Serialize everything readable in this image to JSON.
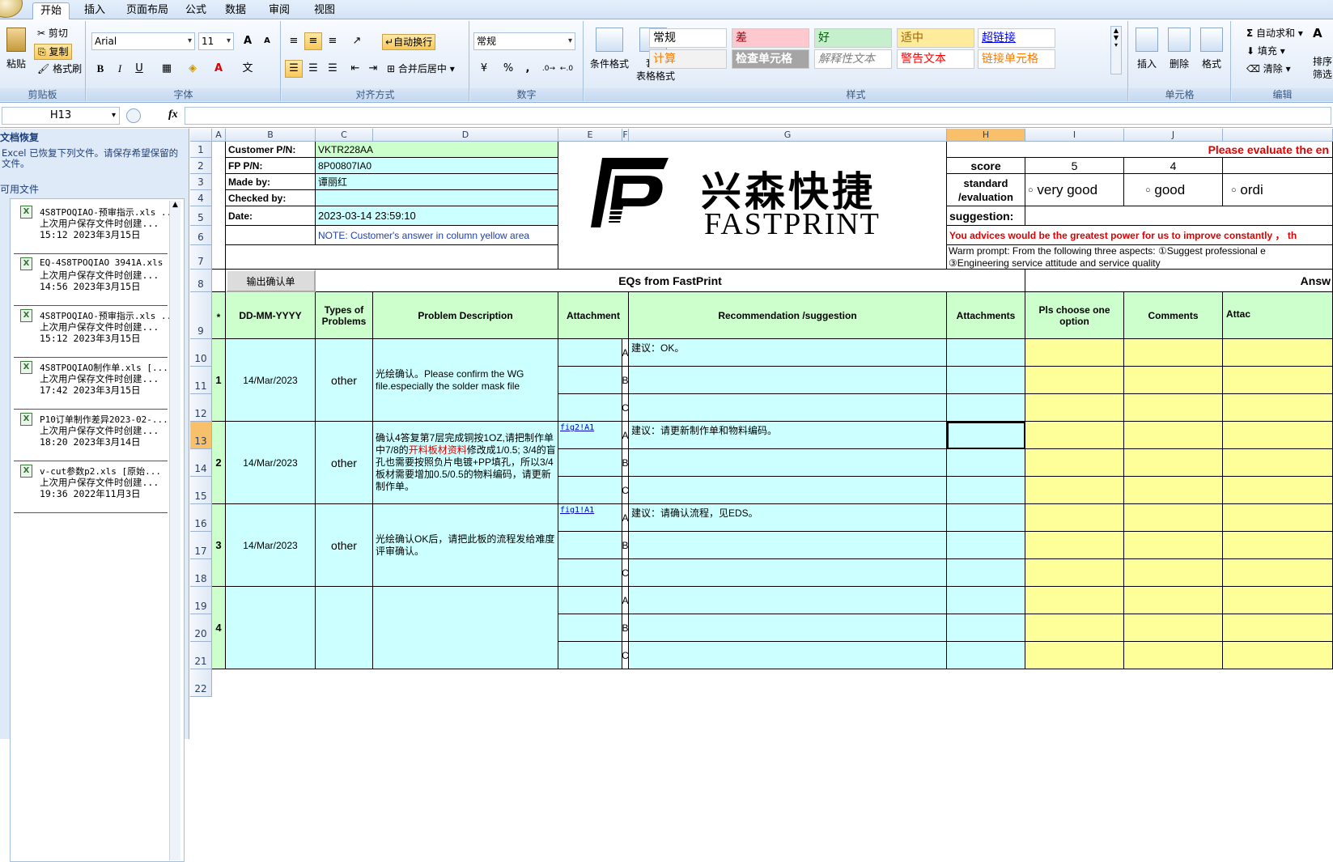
{
  "ribbon_tabs": [
    "开始",
    "插入",
    "页面布局",
    "公式",
    "数据",
    "审阅",
    "视图"
  ],
  "clipboard": {
    "paste": "粘贴",
    "cut": "剪切",
    "copy": "复制",
    "format_painter": "格式刷",
    "label": "剪贴板"
  },
  "font": {
    "name": "Arial",
    "size": "11",
    "grow": "A",
    "shrink": "A",
    "bold": "B",
    "italic": "I",
    "underline": "U",
    "label": "字体"
  },
  "alignment": {
    "wrap": "自动换行",
    "merge": "合并后居中",
    "label": "对齐方式"
  },
  "number": {
    "format": "常规",
    "percent": "%",
    "comma": ",",
    "label": "数字"
  },
  "styles": {
    "cond": "条件格式",
    "table": "套用\n表格格式",
    "label": "样式",
    "cells": [
      {
        "text": "常规",
        "bg": "#ffffff",
        "fg": "#000000"
      },
      {
        "text": "差",
        "bg": "#ffc7ce",
        "fg": "#9c0006"
      },
      {
        "text": "好",
        "bg": "#c6efce",
        "fg": "#006100"
      },
      {
        "text": "适中",
        "bg": "#ffeb9c",
        "fg": "#9c6500"
      },
      {
        "text": "超链接",
        "bg": "#ffffff",
        "fg": "#0000ff"
      },
      {
        "text": "计算",
        "bg": "#f2f2f2",
        "fg": "#fa7d00"
      },
      {
        "text": "检查单元格",
        "bg": "#a5a5a5",
        "fg": "#ffffff"
      },
      {
        "text": "解释性文本",
        "bg": "#ffffff",
        "fg": "#7f7f7f"
      },
      {
        "text": "警告文本",
        "bg": "#ffffff",
        "fg": "#ff0000"
      },
      {
        "text": "链接单元格",
        "bg": "#ffffff",
        "fg": "#fa7d00"
      }
    ]
  },
  "cells_grp": {
    "insert": "插入",
    "delete": "删除",
    "format": "格式",
    "label": "单元格"
  },
  "editing": {
    "autosum": "自动求和",
    "fill": "填充",
    "clear": "清除",
    "sort": "排序\n筛选",
    "label": "编辑"
  },
  "namebox": "H13",
  "fx": "fx",
  "recovery": {
    "title": "文档恢复",
    "message": "Excel 已恢复下列文件。请保存希望保留的文件。",
    "available": "可用文件",
    "items": [
      {
        "file": "4S8TPOQIAO-预审指示.xls ...",
        "sub": "上次用户保存文件时创建...",
        "time": "15:12 2023年3月15日"
      },
      {
        "file": "EQ-4S8TPOQIAO 3941A.xls ...",
        "sub": "上次用户保存文件时创建...",
        "time": "14:56 2023年3月15日"
      },
      {
        "file": "4S8TPOQIAO-预审指示.xls ...",
        "sub": "上次用户保存文件时创建...",
        "time": "15:12 2023年3月15日"
      },
      {
        "file": "4S8TPOQIAO制作单.xls  [...",
        "sub": "上次用户保存文件时创建...",
        "time": "17:42 2023年3月15日"
      },
      {
        "file": "P10订单制作差异2023-02-...",
        "sub": "上次用户保存文件时创建...",
        "time": "18:20 2023年3月14日"
      },
      {
        "file": "v-cut参数p2.xls  [原始...",
        "sub": "上次用户保存文件时创建...",
        "time": "19:36 2022年11月3日"
      }
    ]
  },
  "columns": [
    "A",
    "B",
    "C",
    "D",
    "E",
    "F",
    "G",
    "H",
    "I",
    "J",
    ""
  ],
  "rows": [
    "1",
    "2",
    "3",
    "4",
    "5",
    "6",
    "7",
    "8",
    "9",
    "10",
    "11",
    "12",
    "13",
    "14",
    "15",
    "16",
    "17",
    "18",
    "19",
    "20",
    "21",
    "22"
  ],
  "header": {
    "customer_pn_label": "Customer P/N:",
    "customer_pn": "VKTR228AA",
    "fp_pn_label": "FP P/N:",
    "fp_pn": "8P00807IA0",
    "made_by_label": "Made by:",
    "made_by": "谭丽红",
    "checked_by_label": "Checked by:",
    "checked_by": "",
    "date_label": "Date:",
    "date": "2023-03-14 23:59:10",
    "note": "NOTE: Customer's  answer in column yellow area",
    "output_btn": "输出确认单",
    "logo_cn": "兴森快捷",
    "logo_en": "FASTPRINT"
  },
  "eval": {
    "banner": "Please evaluate the en",
    "score": "score",
    "s5": "5",
    "s4": "4",
    "standard": "standard\n/evaluation",
    "very_good": "very good",
    "good": "good",
    "ordinary": "ordi",
    "suggestion": "suggestion:",
    "advice": "You advices would be the greatest power for us to improve constantly ， th",
    "prompt1": "Warm prompt:  From the following three aspects: ①Suggest professional e",
    "prompt2": "③Engineering service attitude and service quality"
  },
  "table": {
    "eq_title": "EQs from FastPrint",
    "answer_title": "Answ",
    "h_star": "*",
    "h_date": "DD-MM-YYYY",
    "h_types": "Types of\nProblems",
    "h_desc": "Problem Description",
    "h_attach": "Attachment",
    "h_rec": "Recommendation /suggestion",
    "h_attachs": "Attachments",
    "h_choose": "Pls choose one\noption",
    "h_comments": "Comments",
    "h_attac": "Attac",
    "eqs": [
      {
        "no": "1",
        "date": "14/Mar/2023",
        "type": "other",
        "desc": "光绘确认。Please confirm the WG file.especially the solder mask file",
        "desc_red": "",
        "desc_after": "",
        "link": "",
        "a": "建议：OK。",
        "b": "",
        "c": ""
      },
      {
        "no": "2",
        "date": "14/Mar/2023",
        "type": "other",
        "desc": "确认4答复第7层完成铜按1OZ,请把制作单中7/8的",
        "desc_red": "开料板材资料",
        "desc_after": "修改成1/0.5; 3/4的盲孔也需要按照负片电镀+PP填孔，所以3/4板材需要增加0.5/0.5的物料编码，请更新制作单。",
        "link": "fig2!A1",
        "a": "建议：请更新制作单和物料编码。",
        "b": "",
        "c": ""
      },
      {
        "no": "3",
        "date": "14/Mar/2023",
        "type": "other",
        "desc": "光绘确认OK后，请把此板的流程发给难度评审确认。",
        "desc_red": "",
        "desc_after": "",
        "link": "fig1!A1",
        "a": "建议：请确认流程，见EDS。",
        "b": "",
        "c": ""
      },
      {
        "no": "4",
        "date": "",
        "type": "",
        "desc": "",
        "desc_red": "",
        "desc_after": "",
        "link": "",
        "a": "",
        "b": "",
        "c": ""
      }
    ],
    "abc": [
      "A",
      "B",
      "C"
    ]
  }
}
